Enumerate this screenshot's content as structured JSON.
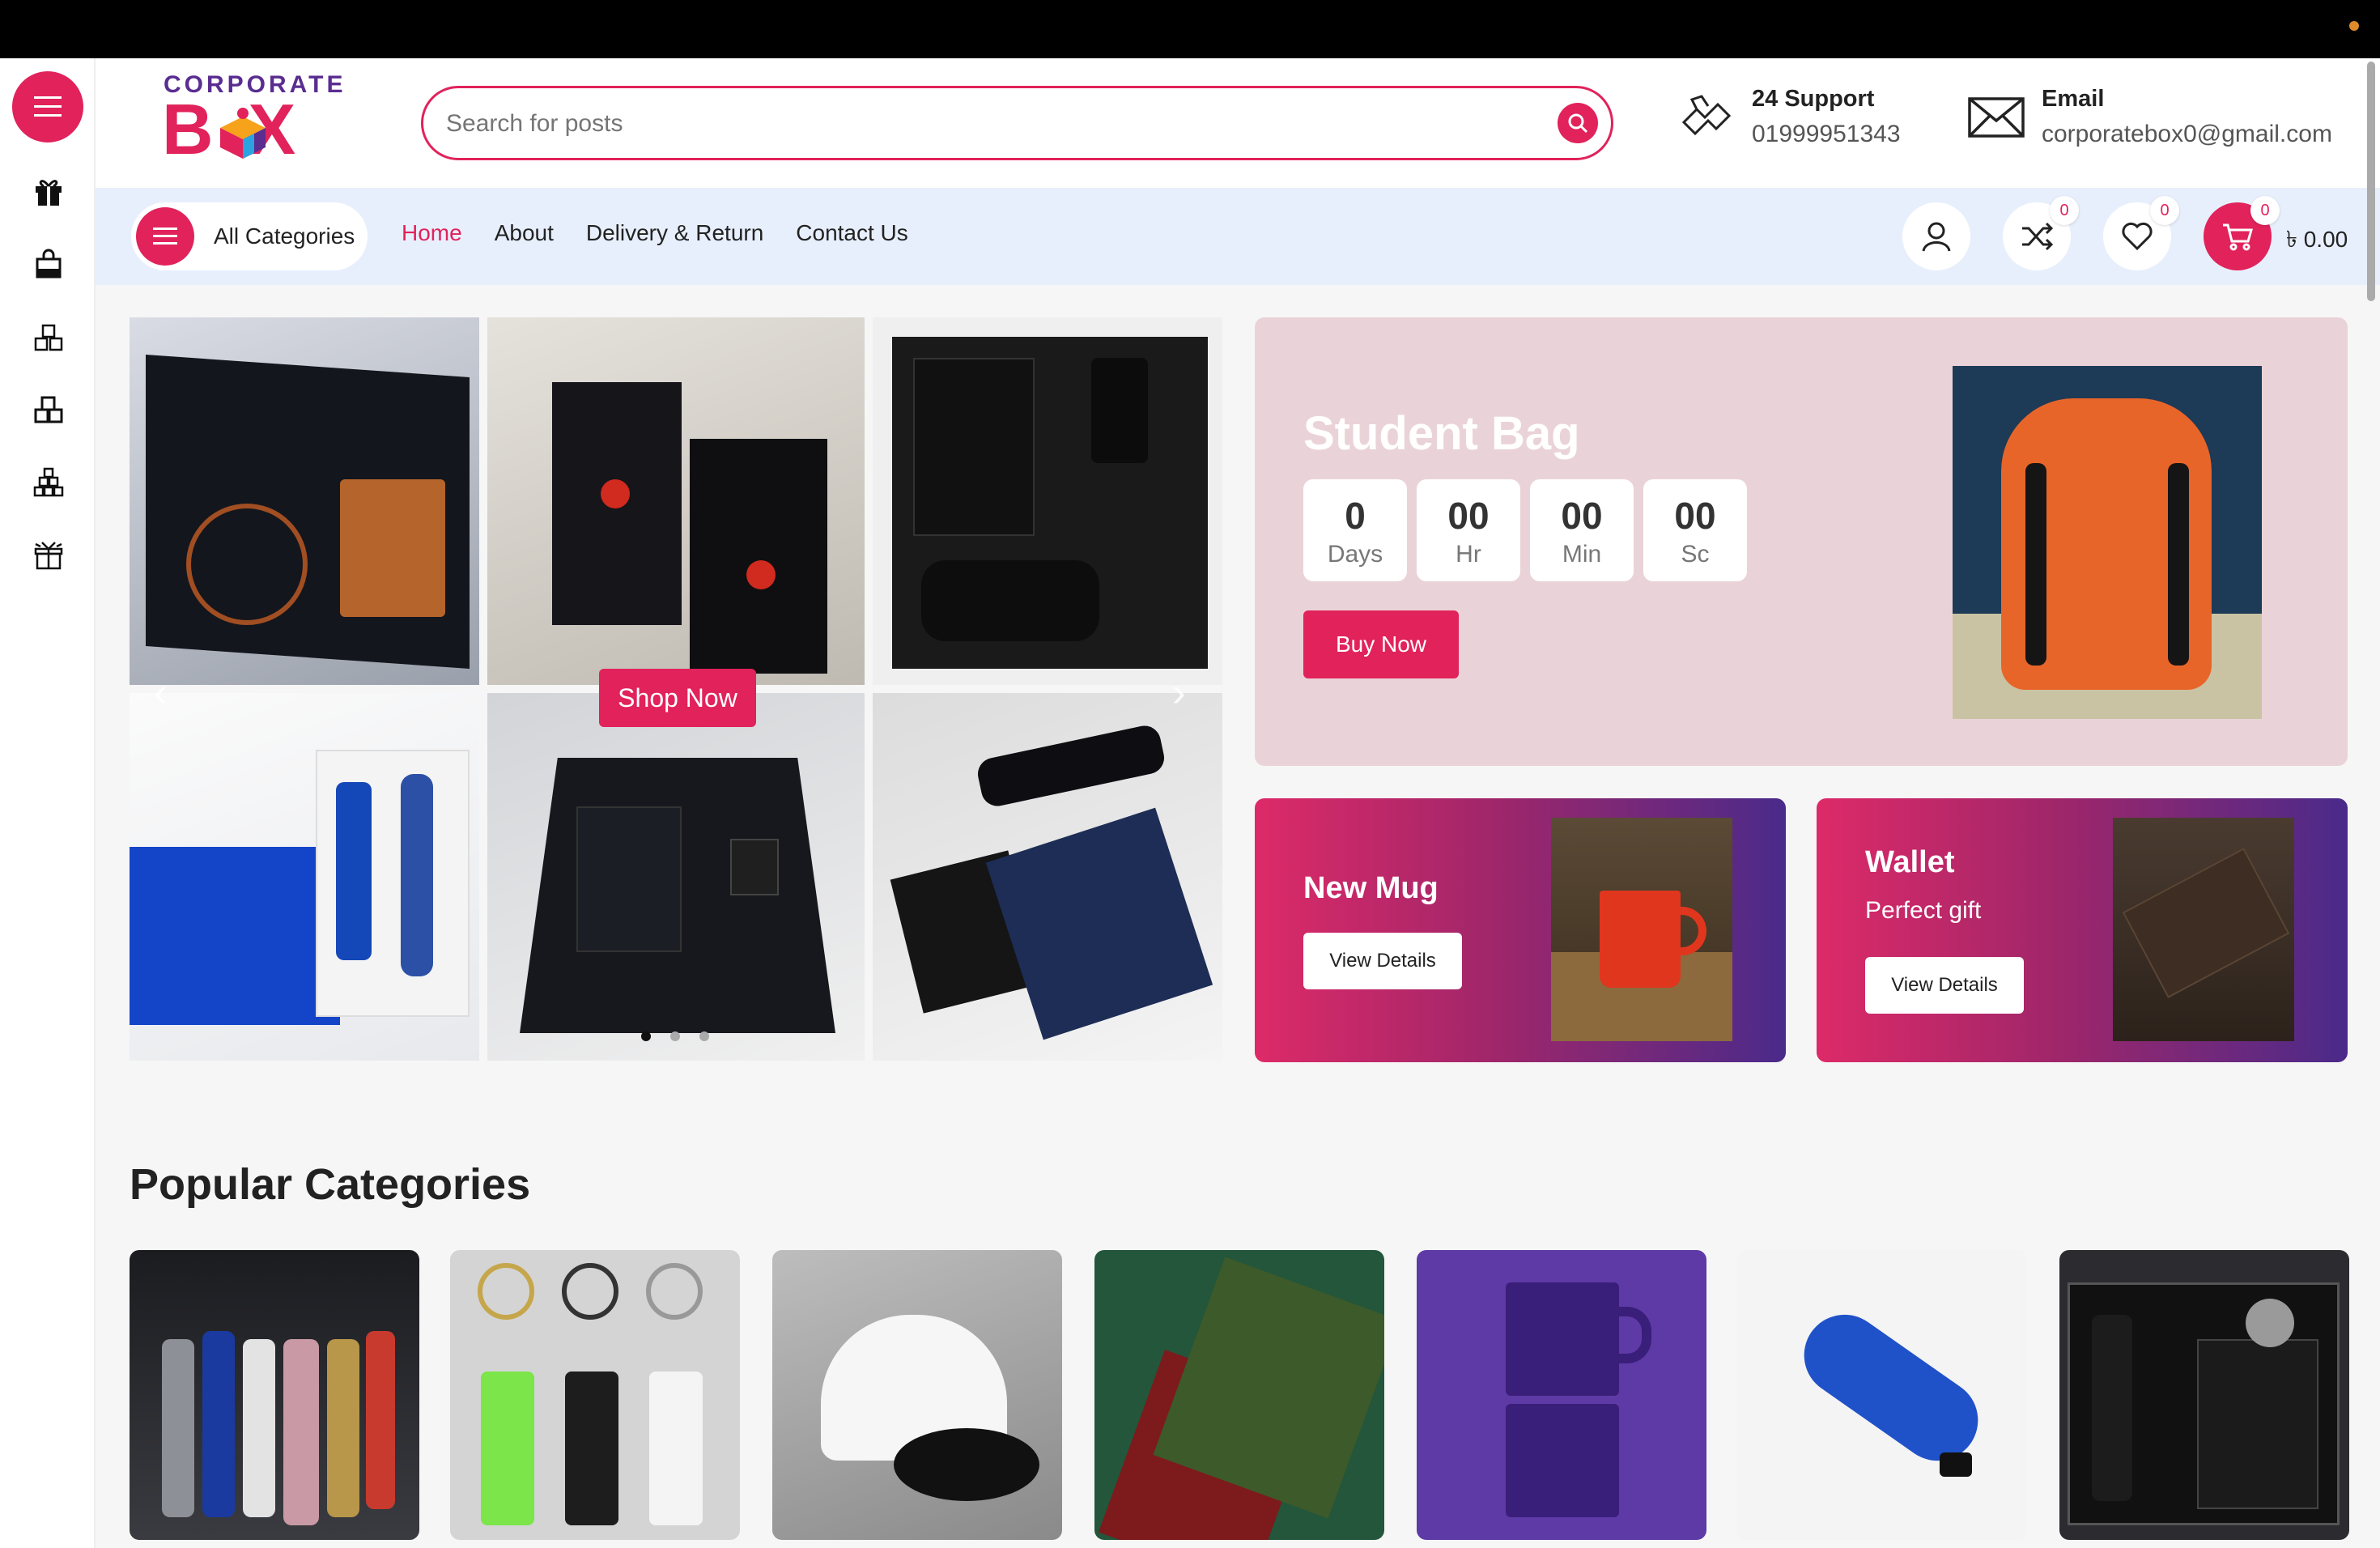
{
  "brand": {
    "top": "CORPORATE",
    "bottom": "BOX"
  },
  "search": {
    "placeholder": "Search for posts"
  },
  "support": {
    "title": "24 Support",
    "value": "01999951343"
  },
  "email": {
    "title": "Email",
    "value": "corporatebox0@gmail.com"
  },
  "nav": {
    "all_categories": "All Categories",
    "menu": [
      "Home",
      "About",
      "Delivery & Return",
      "Contact Us"
    ],
    "active": "Home",
    "compare_count": "0",
    "wishlist_count": "0",
    "cart_count": "0",
    "cart_total": "৳ 0.00"
  },
  "sidebar": {
    "icons": [
      "gift-icon",
      "shopping-bag-icon",
      "stacked-boxes-icon",
      "boxes-icon",
      "warehouse-boxes-icon",
      "gift-box-icon"
    ]
  },
  "hero": {
    "cta": "Shop Now",
    "slides": 3,
    "active_slide": 1
  },
  "promo": {
    "title": "Student Bag",
    "countdown": [
      {
        "value": "0",
        "unit": "Days"
      },
      {
        "value": "00",
        "unit": "Hr"
      },
      {
        "value": "00",
        "unit": "Min"
      },
      {
        "value": "00",
        "unit": "Sc"
      }
    ],
    "cta": "Buy Now"
  },
  "cards": [
    {
      "title": "New Mug",
      "subtitle": "",
      "cta": "View Details"
    },
    {
      "title": "Wallet",
      "subtitle": "Perfect gift",
      "cta": "View Details"
    }
  ],
  "popular": {
    "title": "Popular Categories"
  },
  "colors": {
    "accent": "#e1225b",
    "nav_bg": "#e8effc",
    "promo_bg": "#ead3d8"
  }
}
